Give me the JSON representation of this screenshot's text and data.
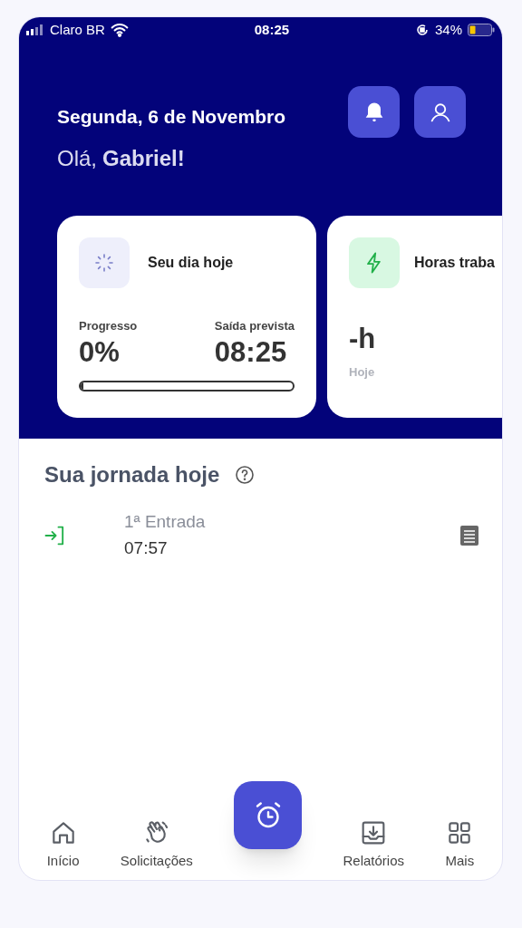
{
  "status_bar": {
    "carrier": "Claro BR",
    "time": "08:25",
    "battery": "34%"
  },
  "header": {
    "date": "Segunda, 6 de Novembro",
    "greeting": "Olá,",
    "name": "Gabriel!"
  },
  "cards": [
    {
      "kind": "progress",
      "title": "Seu dia hoje",
      "stats": [
        {
          "label": "Progresso",
          "value": "0%"
        },
        {
          "label": "Saída prevista",
          "value": "08:25"
        }
      ],
      "level": 0
    },
    {
      "kind": "hours",
      "title": "Horas traba",
      "value": "-h",
      "caption": "Hoje"
    }
  ],
  "journey": {
    "title": "Sua jornada hoje",
    "entries": [
      {
        "label": "1ª Entrada",
        "time": "07:57"
      }
    ]
  },
  "nav": [
    {
      "kind": "home",
      "label": "Início"
    },
    {
      "kind": "wave",
      "label": "Solicitações"
    },
    {
      "kind": "clock"
    },
    {
      "kind": "download",
      "label": "Relatórios"
    },
    {
      "kind": "grid",
      "label": "Mais"
    }
  ]
}
